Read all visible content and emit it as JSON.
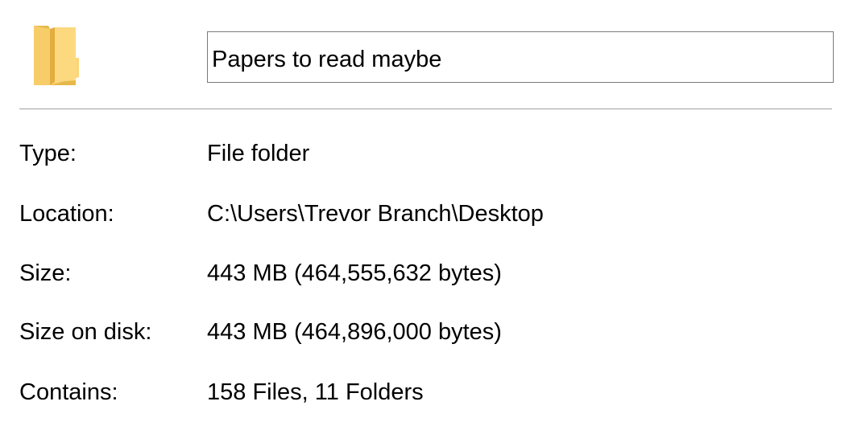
{
  "header": {
    "icon": "folder-icon",
    "icon_colors": {
      "back": "#e6b84a",
      "front": "#fbd67a",
      "shade": "#f2c35c"
    },
    "name_value": "Papers to read maybe"
  },
  "properties": {
    "type": {
      "label": "Type:",
      "value": "File folder"
    },
    "location": {
      "label": "Location:",
      "value": "C:\\Users\\Trevor Branch\\Desktop"
    },
    "size": {
      "label": "Size:",
      "value": "443 MB (464,555,632 bytes)"
    },
    "size_on_disk": {
      "label": "Size on disk:",
      "value": "443 MB (464,896,000 bytes)"
    },
    "contains": {
      "label": "Contains:",
      "value": "158 Files, 11 Folders"
    }
  }
}
